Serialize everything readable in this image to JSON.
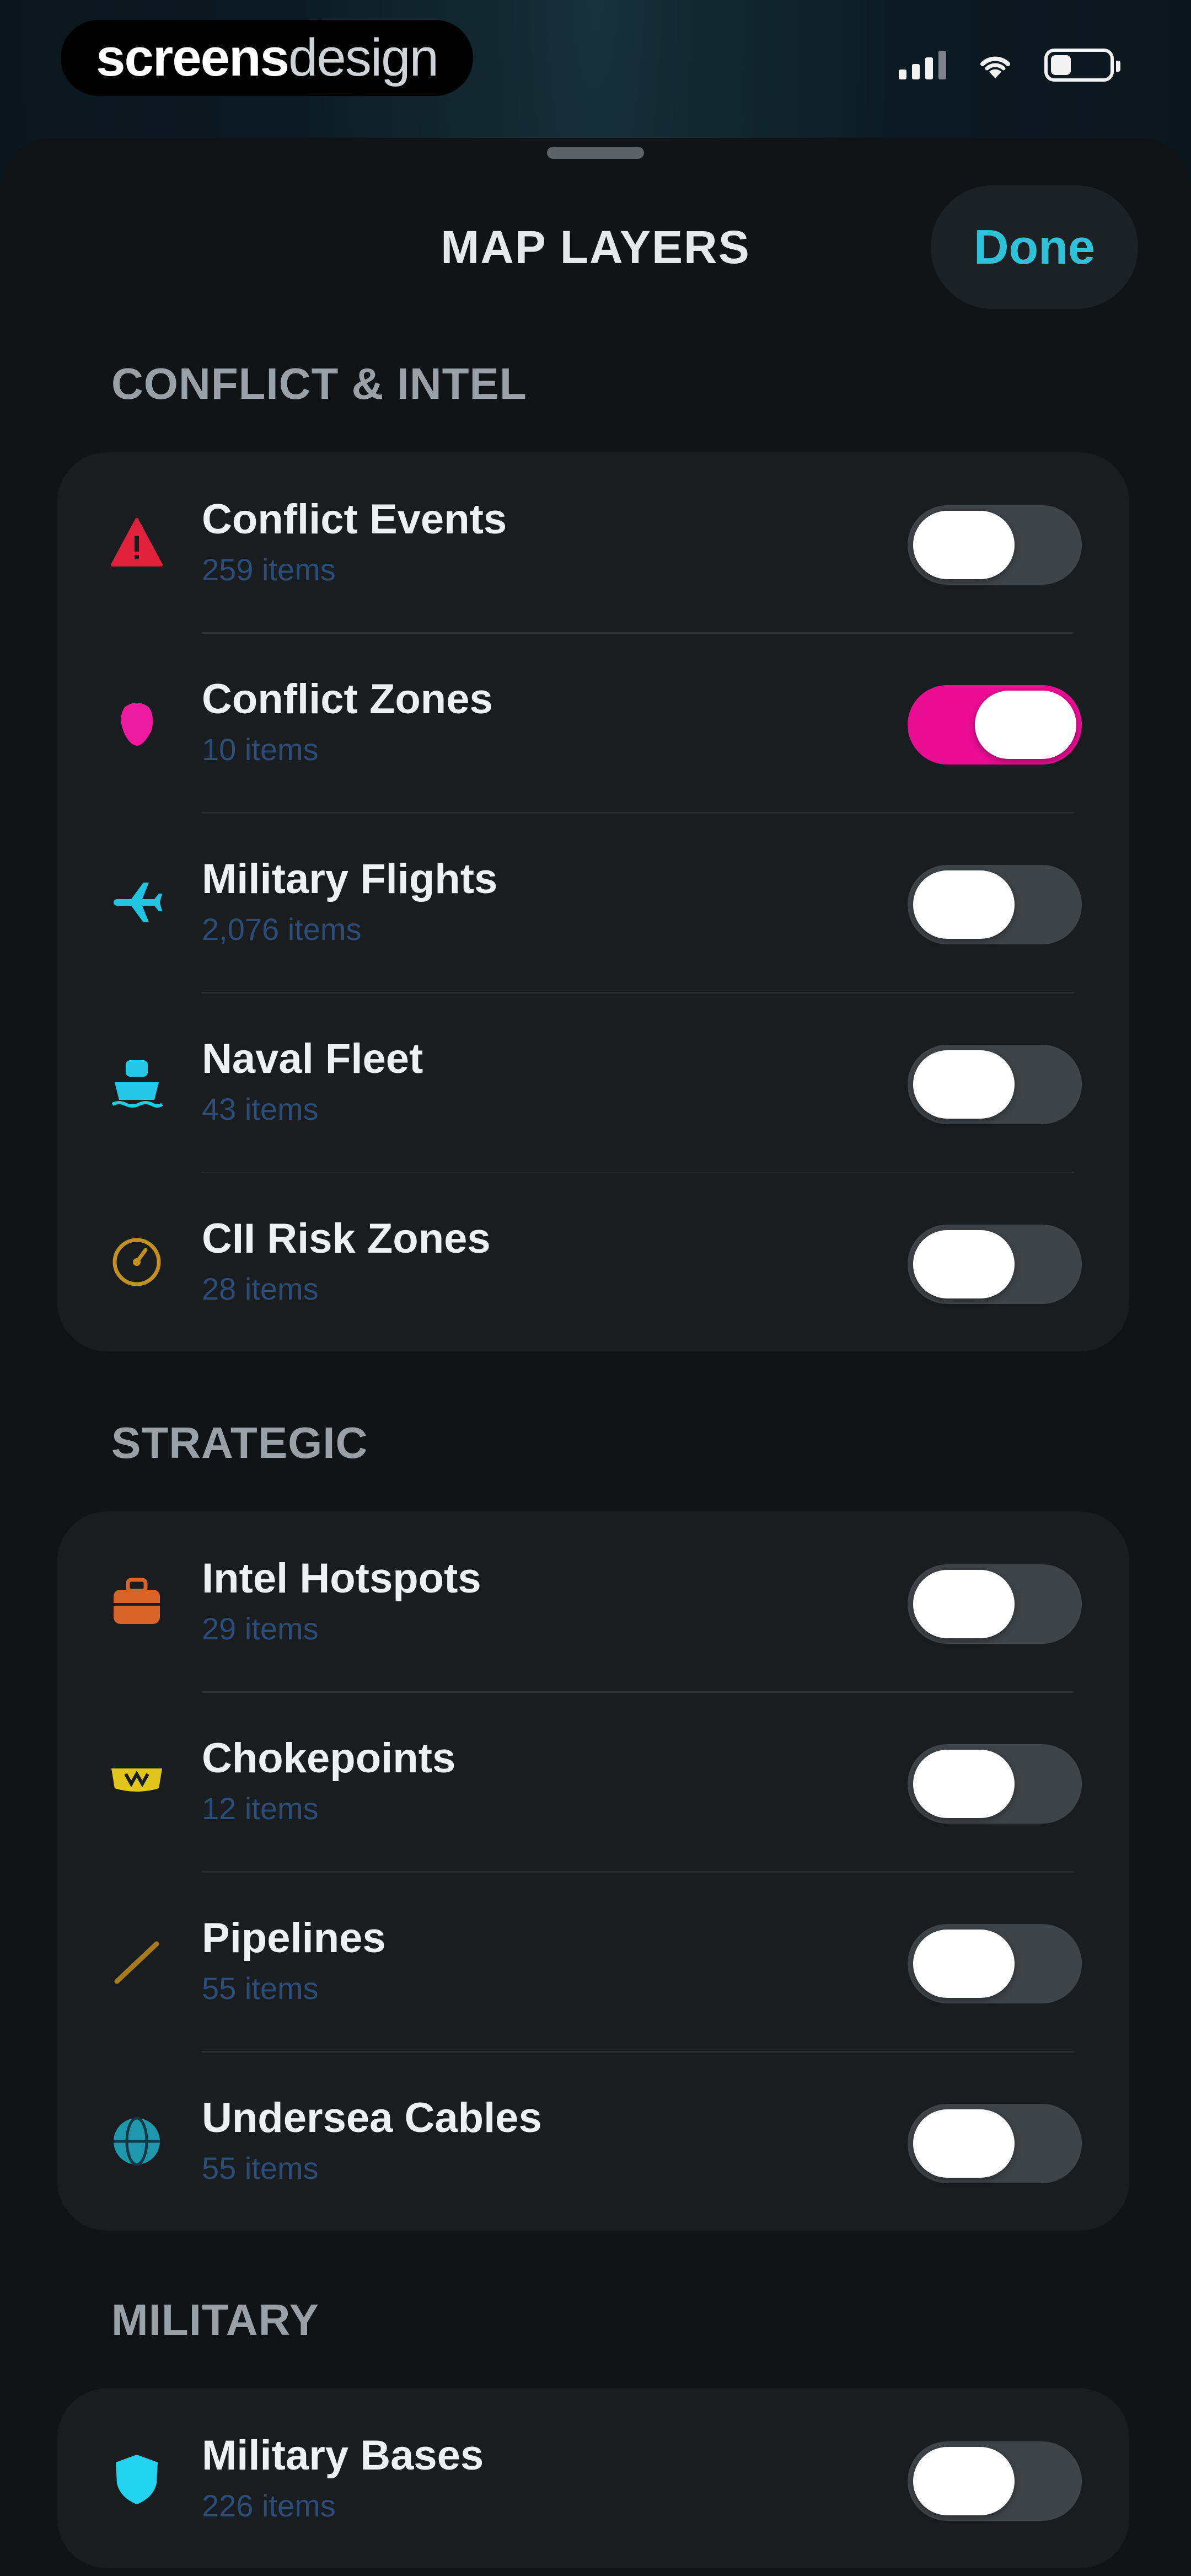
{
  "status_bar": {
    "brand_bold": "screens",
    "brand_light": "design",
    "battery_level": 0.35
  },
  "sheet": {
    "title": "MAP LAYERS",
    "done_label": "Done"
  },
  "colors": {
    "accent": "#2fc1d8",
    "toggle_on": "#ea0d93",
    "toggle_off": "#3f4448"
  },
  "sections": [
    {
      "header": "CONFLICT & INTEL",
      "rows": [
        {
          "title": "Conflict Events",
          "subtitle": "259 items",
          "on": false,
          "icon": "warning-triangle-icon",
          "icon_color": "#e1213c"
        },
        {
          "title": "Conflict Zones",
          "subtitle": "10 items",
          "on": true,
          "icon": "zone-blob-icon",
          "icon_color": "#ee1aa0"
        },
        {
          "title": "Military Flights",
          "subtitle": "2,076 items",
          "on": false,
          "icon": "airplane-icon",
          "icon_color": "#20c4e0"
        },
        {
          "title": "Naval Fleet",
          "subtitle": "43 items",
          "on": false,
          "icon": "ship-icon",
          "icon_color": "#25c8e8"
        },
        {
          "title": "CII Risk Zones",
          "subtitle": "28 items",
          "on": false,
          "icon": "gauge-icon",
          "icon_color": "#c2901f"
        }
      ]
    },
    {
      "header": "STRATEGIC",
      "rows": [
        {
          "title": "Intel Hotspots",
          "subtitle": "29 items",
          "on": false,
          "icon": "briefcase-icon",
          "icon_color": "#d9642a"
        },
        {
          "title": "Chokepoints",
          "subtitle": "12 items",
          "on": false,
          "icon": "chokepoint-icon",
          "icon_color": "#e2c61c"
        },
        {
          "title": "Pipelines",
          "subtitle": "55 items",
          "on": false,
          "icon": "pipeline-icon",
          "icon_color": "#a77a1e"
        },
        {
          "title": "Undersea Cables",
          "subtitle": "55 items",
          "on": false,
          "icon": "globe-icon",
          "icon_color": "#1e97ad"
        }
      ]
    },
    {
      "header": "MILITARY",
      "rows": [
        {
          "title": "Military Bases",
          "subtitle": "226 items",
          "on": false,
          "icon": "shield-icon",
          "icon_color": "#22d3ef"
        }
      ]
    }
  ]
}
